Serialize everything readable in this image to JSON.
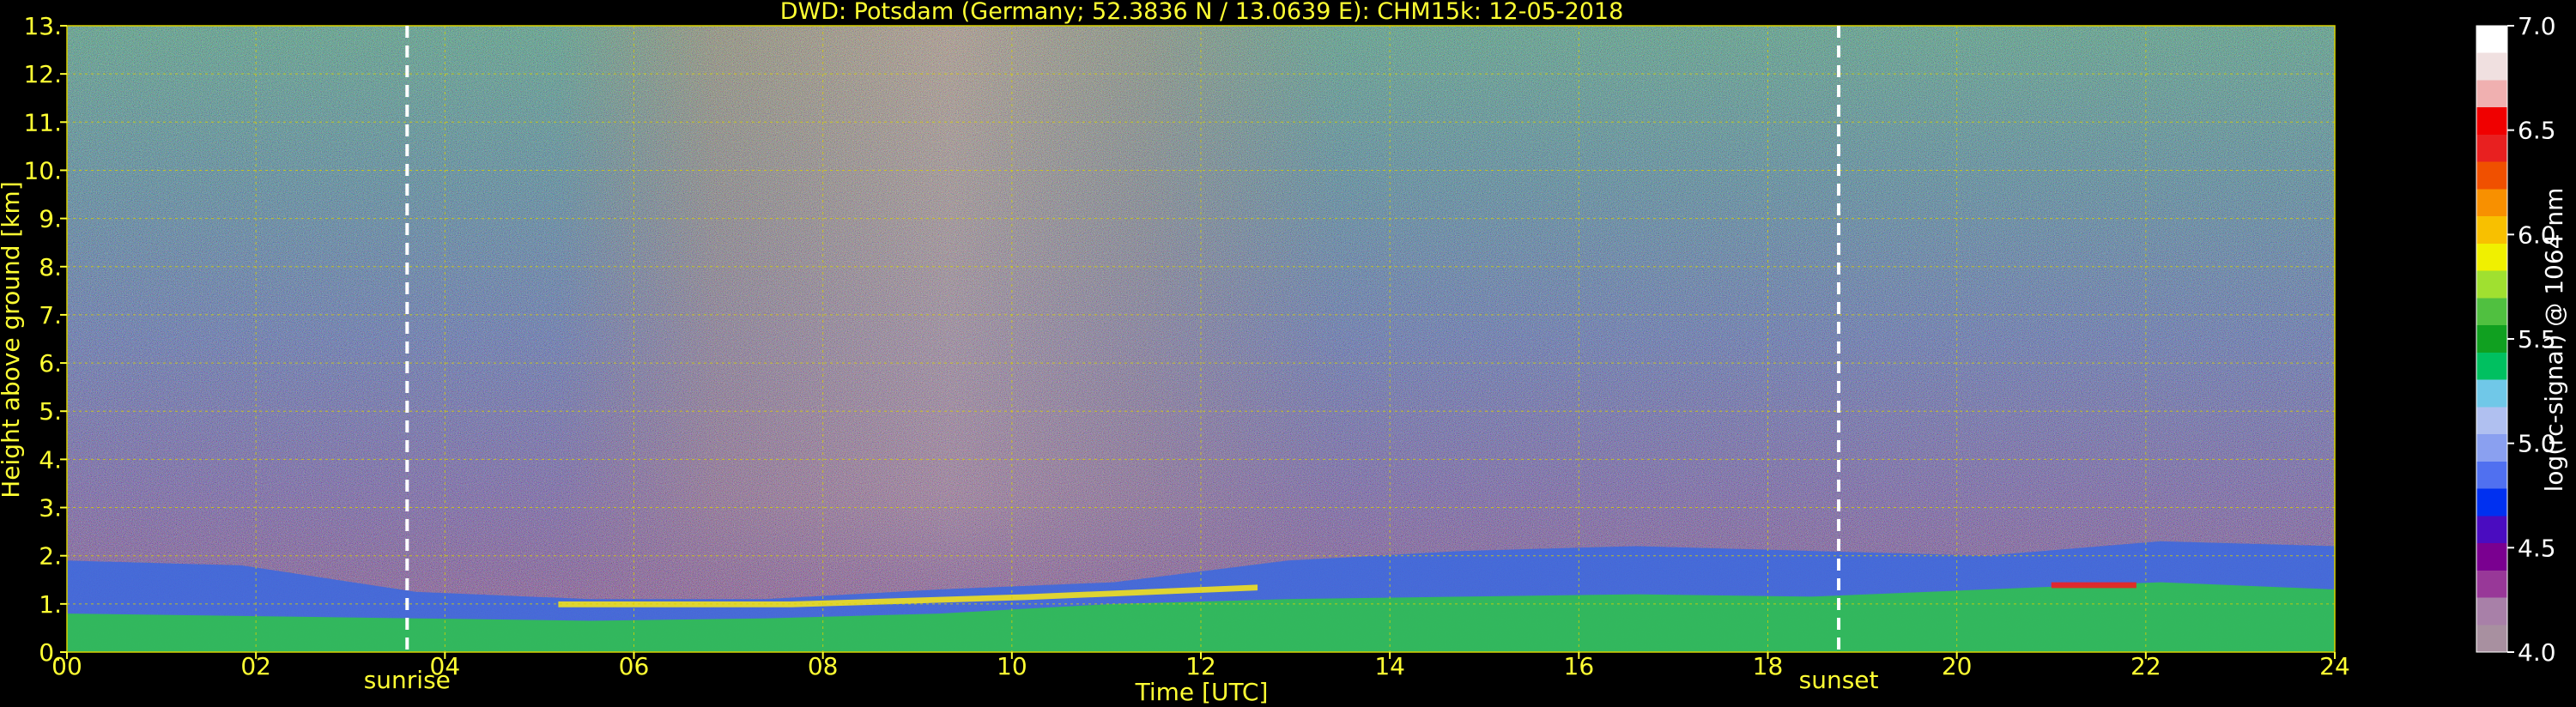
{
  "colors": {
    "background": "#000000",
    "label_yellow": "#ffff33",
    "grid_yellow": "#d8d000",
    "marker_white": "#ffffff"
  },
  "chart_data": {
    "type": "heatmap",
    "title": "DWD: Potsdam (Germany; 52.3836 N / 13.0639 E):    CHM15k: 12-05-2018",
    "xlabel": "Time [UTC]",
    "ylabel": "Height above ground [km]",
    "colorbar_label": "log(rc-signal) @ 1064 nm",
    "xlim": [
      0,
      24
    ],
    "ylim": [
      0,
      13
    ],
    "clim": [
      4.0,
      7.0
    ],
    "x_ticks": [
      0,
      2,
      4,
      6,
      8,
      10,
      12,
      14,
      16,
      18,
      20,
      22,
      24
    ],
    "x_tick_labels": [
      "00",
      "02",
      "04",
      "06",
      "08",
      "10",
      "12",
      "14",
      "16",
      "18",
      "20",
      "22",
      "24"
    ],
    "y_ticks": [
      0,
      1,
      2,
      3,
      4,
      5,
      6,
      7,
      8,
      9,
      10,
      11,
      12,
      13
    ],
    "y_tick_labels": [
      "0.",
      "1.",
      "2.",
      "3.",
      "4.",
      "5.",
      "6.",
      "7.",
      "8.",
      "9.",
      "10.",
      "11.",
      "12.",
      "13."
    ],
    "colorbar_ticks": [
      4.0,
      4.5,
      5.0,
      5.5,
      6.0,
      6.5,
      7.0
    ],
    "colorbar_tick_labels": [
      "4.0",
      "4.5",
      "5.0",
      "5.5",
      "6.0",
      "6.5",
      "7.0"
    ],
    "grid": true,
    "markers": [
      {
        "label": "sunrise",
        "time_utc": 3.6
      },
      {
        "label": "sunset",
        "time_utc": 18.75
      }
    ],
    "colormap": [
      "#a890a0",
      "#a880a8",
      "#983898",
      "#7a0090",
      "#4a0cc0",
      "#0030f0",
      "#5070f0",
      "#8aa0f0",
      "#b0c0f0",
      "#70c8e8",
      "#00c060",
      "#10a020",
      "#50c040",
      "#a0e030",
      "#f0f000",
      "#f8c000",
      "#f89000",
      "#f05000",
      "#e82020",
      "#f00000",
      "#f0b0b0",
      "#f0e0e0",
      "#ffffff"
    ],
    "layers": [
      {
        "name": "residual layer",
        "start": 0,
        "end": 24,
        "top_km": [
          1.9,
          1.8,
          1.25,
          1.1,
          1.1,
          1.3,
          1.45,
          1.9,
          2.1,
          2.2,
          2.1,
          2.0,
          2.3,
          2.2
        ]
      },
      {
        "name": "mixing layer",
        "start": 0,
        "end": 24,
        "top_km": [
          0.8,
          0.75,
          0.7,
          0.65,
          0.7,
          0.8,
          1.0,
          1.1,
          1.15,
          1.2,
          1.15,
          1.3,
          1.45,
          1.3
        ]
      },
      {
        "name": "cloud base",
        "start": 5.2,
        "end": 12.6,
        "top_km": [
          1.05,
          1.05,
          1.2,
          1.4
        ]
      },
      {
        "name": "cloud",
        "start": 21.0,
        "end": 21.9,
        "top_km": [
          1.45
        ]
      }
    ]
  }
}
